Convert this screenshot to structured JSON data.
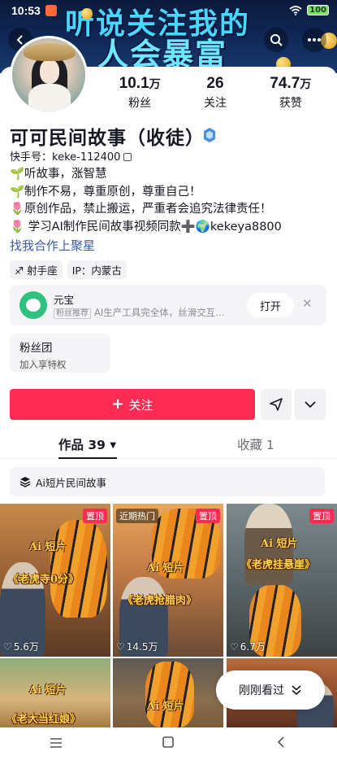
{
  "status_bar": {
    "time": "10:53",
    "battery": "100"
  },
  "banner": {
    "line1": "听说关注我的",
    "line2": "人会暴富"
  },
  "profile": {
    "name": "可可民间故事（收徒）",
    "account_label": "快手号：keke-112400",
    "stats": [
      {
        "num": "10.1",
        "unit": "万",
        "label": "粉丝"
      },
      {
        "num": "26",
        "unit": "",
        "label": "关注"
      },
      {
        "num": "74.7",
        "unit": "万",
        "label": "获赞"
      }
    ],
    "bio": [
      {
        "emoji": "🌱",
        "text": "听故事，涨智慧"
      },
      {
        "emoji": "🌱",
        "text": "制作不易，尊重原创，尊重自己！"
      },
      {
        "emoji": "🌷",
        "text": "原创作品，禁止搬运，严重者会追究法律责任！"
      },
      {
        "emoji": "🌷",
        "text": " 学习AI制作民间故事视频同款➕🌍kekeya8800"
      }
    ],
    "link": "找我合作上聚星",
    "tags": [
      "♐ 射手座",
      "IP：内蒙古"
    ]
  },
  "app_card": {
    "name": "元宝",
    "badge": "粉丝推荐",
    "desc": "AI生产工具完全体，丝滑交互…",
    "open_label": "打开",
    "close_glyph": "✕"
  },
  "fan_group": {
    "title": "粉丝团",
    "sub": "加入享特权"
  },
  "actions": {
    "follow_label": "关注",
    "plus": "+"
  },
  "tabs": {
    "works": "作品 39",
    "collect": "收藏 1"
  },
  "collection_label": "Ai短片民间故事",
  "videos": [
    {
      "badge_right": "置顶",
      "ai": "Ai 短片",
      "title": "《老虎寺0分》",
      "likes": "5.6万"
    },
    {
      "badge_left": "近期热门",
      "badge_right": "置顶",
      "ai": "Ai 短片",
      "title": "《老虎抢腊肉》",
      "likes": "14.5万"
    },
    {
      "badge_right": "置顶",
      "ai": "Ai 短片",
      "title": "《老虎挂悬崖》",
      "likes": "6.7万"
    },
    {
      "ai": "Ai 短片",
      "title": "《老大当红娘》"
    },
    {
      "ai": "Ai 短片"
    },
    {}
  ],
  "watched_label": "刚刚看过",
  "colors": {
    "accent": "#fe2c55",
    "link": "#3b5ca8"
  }
}
